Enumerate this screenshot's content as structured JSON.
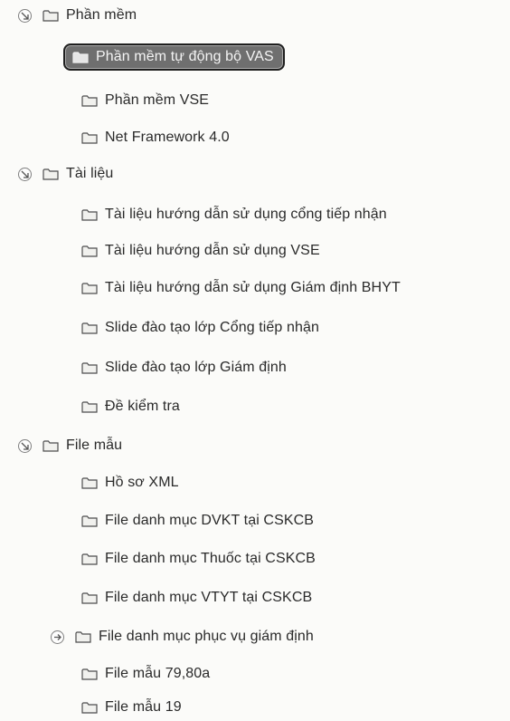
{
  "tree": {
    "groups": [
      {
        "label": "Phần mềm",
        "expand_icon": "collapse-arrow-icon",
        "children": [
          {
            "label": "Phần mềm tự động bộ VAS",
            "selected": true
          },
          {
            "label": "Phần mềm VSE"
          },
          {
            "label": "Net Framework 4.0"
          }
        ]
      },
      {
        "label": "Tài liệu",
        "expand_icon": "collapse-arrow-icon",
        "children": [
          {
            "label": "Tài liệu hướng dẫn sử dụng cổng tiếp nhận"
          },
          {
            "label": "Tài liệu hướng dẫn sử dụng VSE"
          },
          {
            "label": "Tài liệu hướng dẫn sử dụng Giám định BHYT"
          },
          {
            "label": "Slide đào tạo lớp Cổng tiếp nhận"
          },
          {
            "label": "Slide đào tạo lớp Giám định"
          },
          {
            "label": "Đề kiểm tra"
          }
        ]
      },
      {
        "label": "File mẫu",
        "expand_icon": "collapse-arrow-icon",
        "children": [
          {
            "label": "Hồ sơ XML"
          },
          {
            "label": "File danh mục DVKT tại CSKCB"
          },
          {
            "label": "File danh mục Thuốc tại CSKCB"
          },
          {
            "label": "File danh mục VTYT tại CSKCB"
          },
          {
            "label": "File danh mục phục vụ giám định",
            "expand_icon": "expand-arrow-icon"
          },
          {
            "label": "File mẫu 79,80a"
          },
          {
            "label": "File mẫu 19"
          }
        ]
      }
    ]
  },
  "colors": {
    "background": "#fbfbf9",
    "selected_background": "#6f6f6f",
    "selected_border": "#1f1f1f",
    "text": "#2a2a2a"
  }
}
